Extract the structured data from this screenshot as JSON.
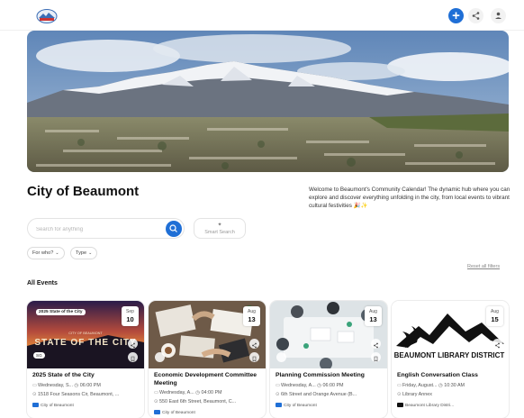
{
  "header": {
    "logo_label": "BEAUMONT",
    "add_label": "+",
    "icons": [
      "plus-icon",
      "share-icon",
      "user-icon"
    ]
  },
  "page": {
    "title": "City of Beaumont",
    "welcome_text": "Welcome to Beaumont's Community Calendar! The dynamic hub where you can explore and discover everything unfolding in the city, from local events to vibrant cultural festivities 🎉✨"
  },
  "search": {
    "placeholder": "Search for anything",
    "smart_icon": "✦",
    "smart_label": "Smart Search"
  },
  "filters": {
    "who_label": "For who?",
    "type_label": "Type",
    "chevron": "⌄",
    "reset_label": "Reset all filters"
  },
  "events": {
    "section_title": "All Events",
    "items": [
      {
        "title": "2025 State of the City",
        "month": "Sep",
        "day": "10",
        "date_time": "Wednesday, S...  ◷ 06:00 PM",
        "location": "1518 Four Seasons Cir, Beaumont, ...",
        "organizer": "City of Beaumont",
        "image_badge": "2025 State of the City",
        "image_heading": "STATE OF THE CITY",
        "image_subheading": "CITY OF BEAUMONT",
        "image_pill": "SG"
      },
      {
        "title": "Economic Development Committee Meeting",
        "month": "Aug",
        "day": "13",
        "date_time": "Wednesday, A...  ◷ 04:00 PM",
        "location": "550 East 6th Street, Beaumont, C...",
        "organizer": "City of Beaumont"
      },
      {
        "title": "Planning Commission Meeting",
        "month": "Aug",
        "day": "13",
        "date_time": "Wednesday, A...  ◷ 06:00 PM",
        "location": "6th Street and Orange Avenue (B...",
        "organizer": "City of Beaumont"
      },
      {
        "title": "English Conversation Class",
        "month": "Aug",
        "day": "15",
        "date_time": "Friday, August...  ◷ 10:30 AM",
        "location": "Library Annex",
        "organizer": "Beaumont Library Distri...",
        "image_heading": "BEAUMONT LIBRARY DISTRICT"
      }
    ]
  },
  "colors": {
    "accent": "#1f6fd6",
    "text": "#111111"
  }
}
